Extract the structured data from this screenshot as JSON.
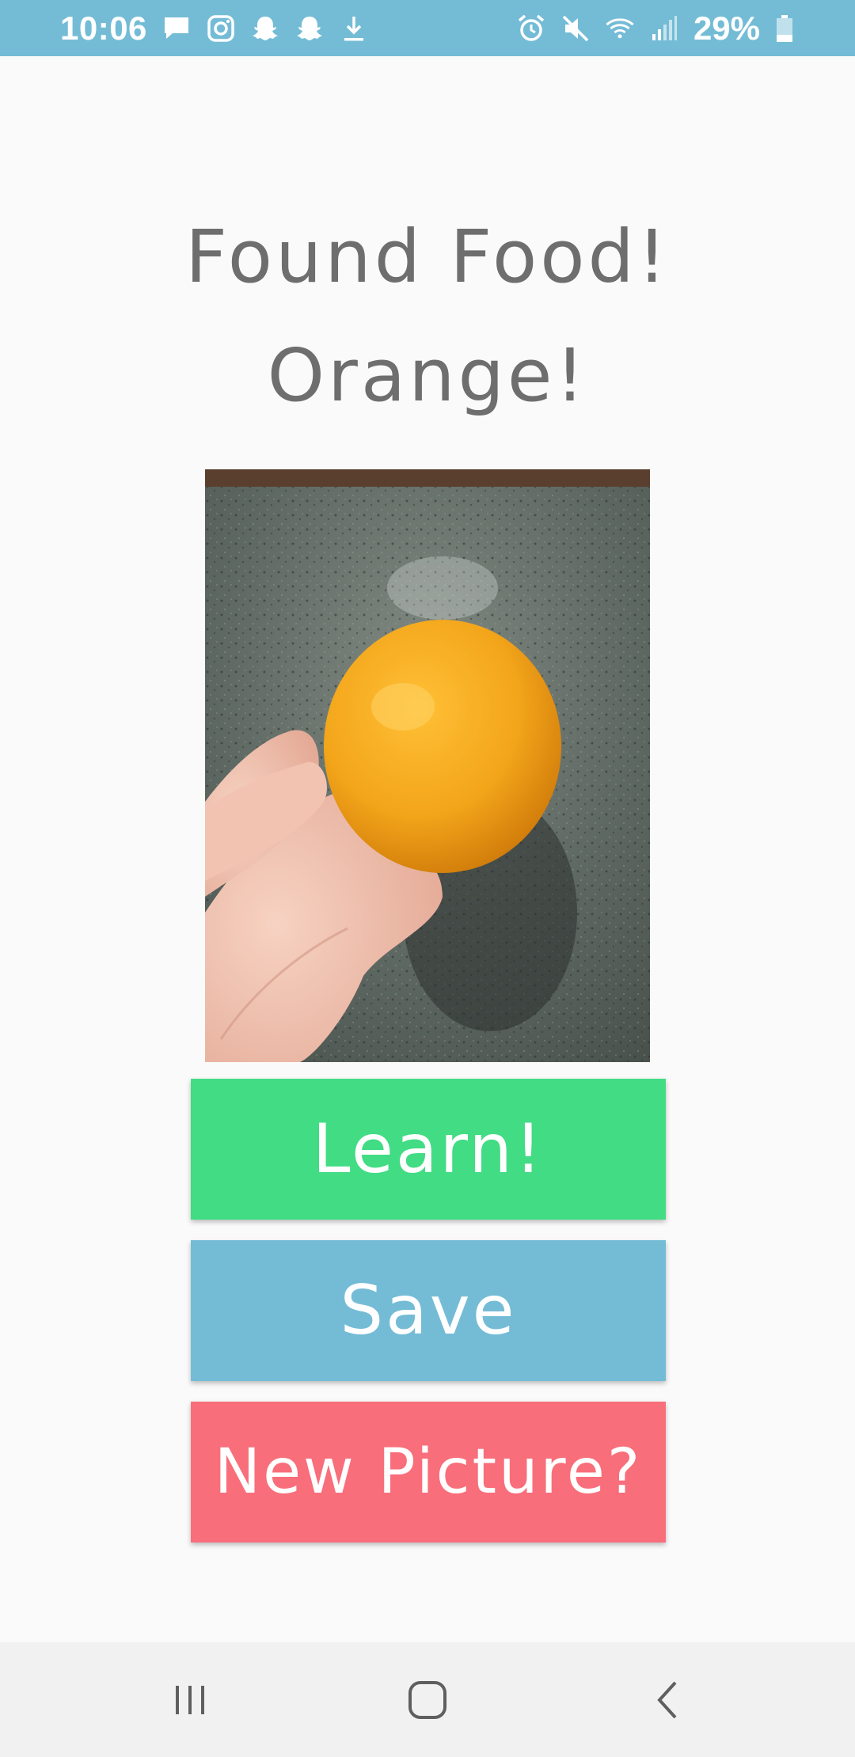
{
  "status_bar": {
    "time": "10:06",
    "battery": "29%",
    "left_icons": [
      "message-icon",
      "instagram-icon",
      "snapchat-icon",
      "snapchat-icon",
      "download-icon"
    ],
    "right_icons": [
      "alarm-icon",
      "mute-icon",
      "wifi-icon",
      "signal-icon",
      "battery-icon"
    ],
    "color": "#74bcd6"
  },
  "title": {
    "line1": "Found Food!",
    "line2": "Orange!",
    "color": "#6e6e6e"
  },
  "photo": {
    "subject": "orange-photo"
  },
  "buttons": {
    "learn": {
      "label": "Learn!",
      "color": "#41dc83"
    },
    "save": {
      "label": "Save",
      "color": "#74bcd6"
    },
    "new_picture": {
      "label": "New Picture?",
      "color": "#f86e7a"
    }
  },
  "nav_bar": {
    "icons": [
      "recent-apps-icon",
      "home-icon",
      "back-icon"
    ]
  }
}
